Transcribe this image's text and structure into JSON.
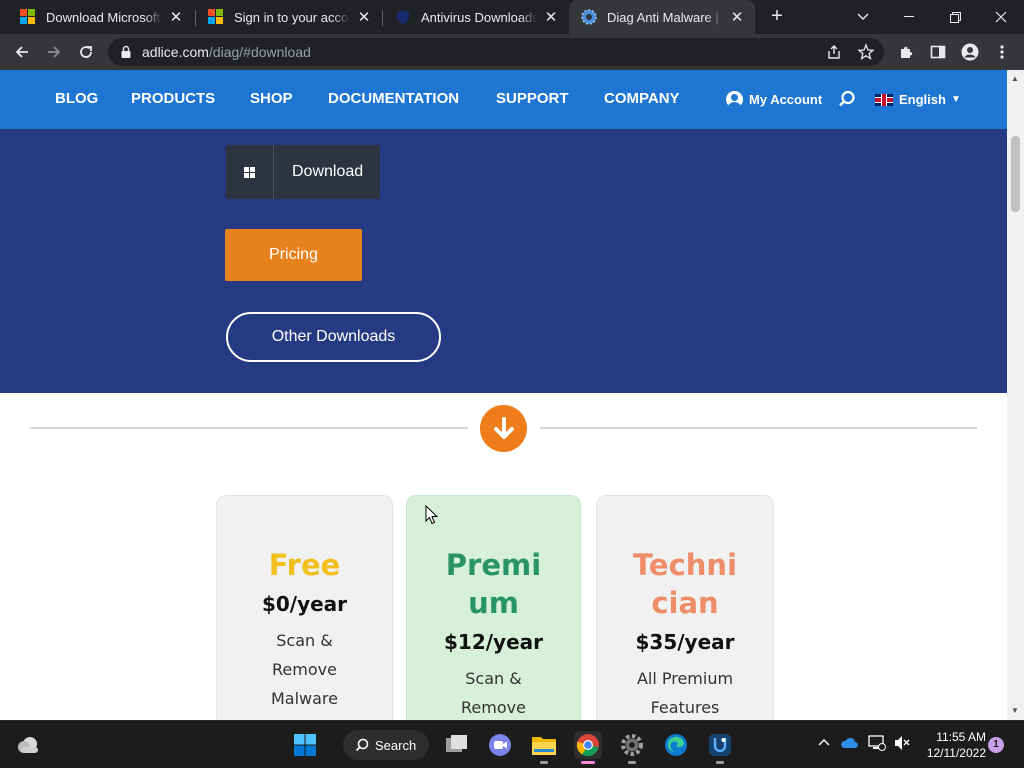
{
  "browser": {
    "tabs": [
      {
        "title": "Download Microsoft Te",
        "favicon": "microsoft-logo-icon"
      },
      {
        "title": "Sign in to your account",
        "favicon": "microsoft-logo-icon"
      },
      {
        "title": "Antivirus Downloads",
        "favicon": "shield-icon"
      },
      {
        "title": "Diag Anti Malware | Di",
        "favicon": "gear-blue-icon",
        "active": true
      }
    ],
    "url_host": "adlice.com",
    "url_path": "/diag/#download"
  },
  "nav": {
    "items": [
      "BLOG",
      "PRODUCTS",
      "SHOP",
      "DOCUMENTATION",
      "SUPPORT",
      "COMPANY"
    ],
    "account": "My Account",
    "language": "English"
  },
  "hero": {
    "download": "Download",
    "pricing": "Pricing",
    "other_downloads": "Other Downloads"
  },
  "plans": [
    {
      "name_line1": "Free",
      "name_line2": "",
      "price": "$0/year",
      "desc": [
        "Scan &",
        "Remove",
        "Malware"
      ]
    },
    {
      "name_line1": "Premi",
      "name_line2": "um",
      "price": "$12/year",
      "desc": [
        "Scan &",
        "Remove"
      ]
    },
    {
      "name_line1": "Techni",
      "name_line2": "cian",
      "price": "$35/year",
      "desc": [
        "All Premium",
        "Features"
      ]
    }
  ],
  "taskbar": {
    "search": "Search",
    "time": "11:55 AM",
    "date": "12/11/2022",
    "notifications": "1"
  },
  "colors": {
    "nav": "#1e76d2",
    "hero": "#253a83",
    "pricing": "#e8821e",
    "free": "#f3bf1d",
    "premium": "#289467",
    "technician": "#ee8d68"
  }
}
